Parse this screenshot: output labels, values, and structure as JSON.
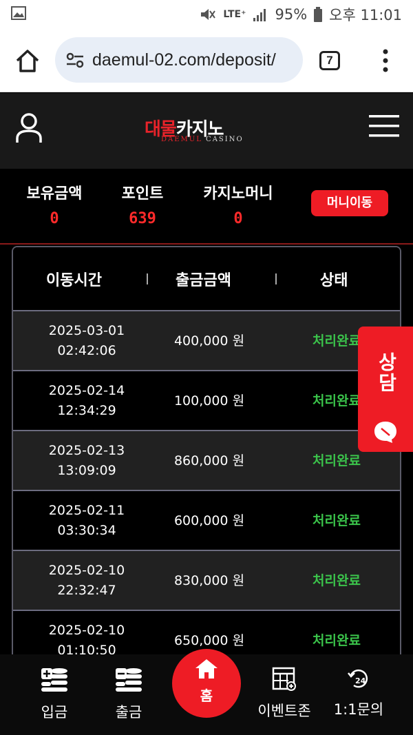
{
  "status_bar": {
    "battery": "95%",
    "network": "LTE⁺",
    "time": "오후 11:01"
  },
  "browser": {
    "url": "daemul-02.com/deposit/",
    "tab_count": "7"
  },
  "logo": {
    "main_red": "대물",
    "main_white": "카지노",
    "sub_red": "DAEMUL",
    "sub_white": " CASINO"
  },
  "balance": {
    "items": [
      {
        "label": "보유금액",
        "value": "0"
      },
      {
        "label": "포인트",
        "value": "639"
      },
      {
        "label": "카지노머니",
        "value": "0"
      }
    ],
    "move_button": "머니이동"
  },
  "table": {
    "headers": [
      "이동시간",
      "출금금액",
      "상태"
    ],
    "rows": [
      {
        "date": "2025-03-01",
        "time": "02:42:06",
        "amount": "400,000 원",
        "status": "처리완료"
      },
      {
        "date": "2025-02-14",
        "time": "12:34:29",
        "amount": "100,000 원",
        "status": "처리완료"
      },
      {
        "date": "2025-02-13",
        "time": "13:09:09",
        "amount": "860,000 원",
        "status": "처리완료"
      },
      {
        "date": "2025-02-11",
        "time": "03:30:34",
        "amount": "600,000 원",
        "status": "처리완료"
      },
      {
        "date": "2025-02-10",
        "time": "22:32:47",
        "amount": "830,000 원",
        "status": "처리완료"
      },
      {
        "date": "2025-02-10",
        "time": "01:10:50",
        "amount": "650,000 원",
        "status": "처리완료"
      }
    ]
  },
  "consult_button": "상담",
  "bottom_nav": {
    "deposit": "입금",
    "withdraw": "출금",
    "home": "홈",
    "events": "이벤트존",
    "inquiry": "1:1문의"
  },
  "colors": {
    "accent_red": "#ee1c25",
    "status_green": "#3bc44b",
    "header_bg": "#191919"
  }
}
